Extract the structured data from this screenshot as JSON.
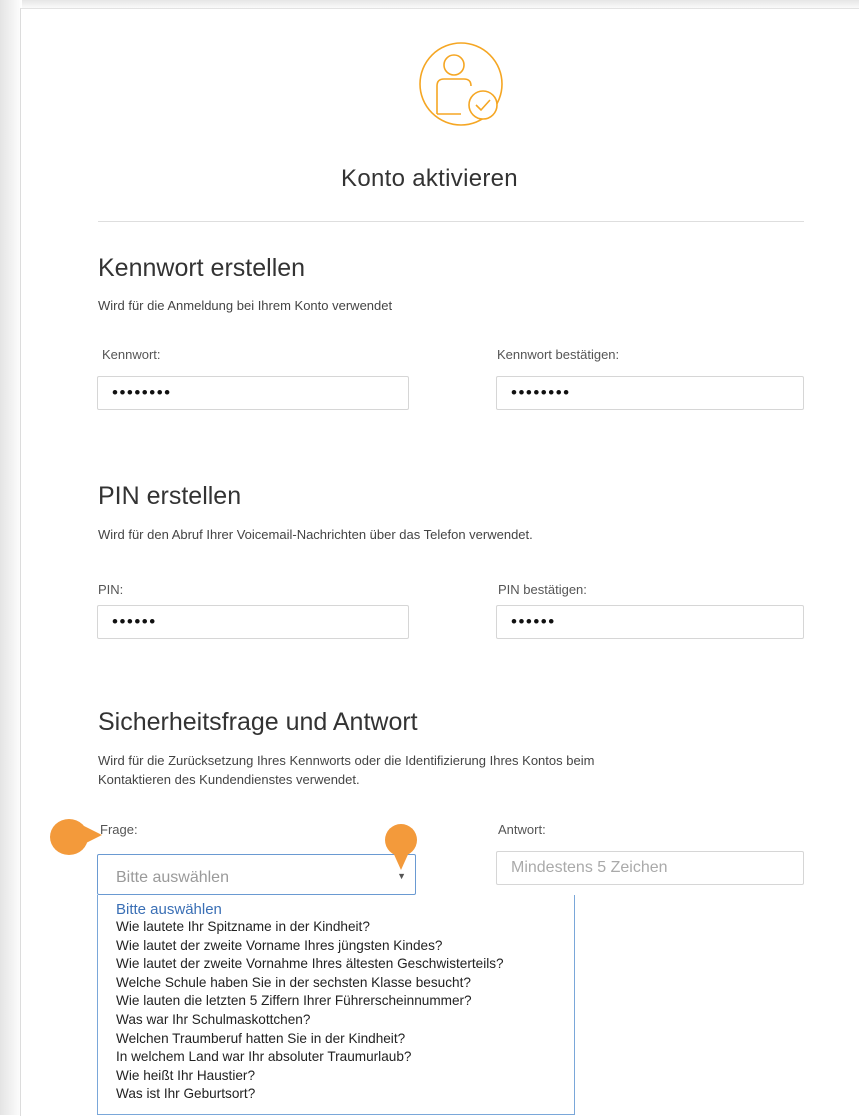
{
  "title": "Konto aktivieren",
  "colors": {
    "accent": "#f5a623",
    "select_border": "#6a9ad2",
    "marker": "#f39a3b",
    "selected_option": "#3a6fb5"
  },
  "password_section": {
    "heading": "Kennwort erstellen",
    "description": "Wird für die Anmeldung bei Ihrem Konto verwendet",
    "password_label": "Kennwort:",
    "password_value": "••••••••",
    "confirm_label": "Kennwort bestätigen:",
    "confirm_value": "••••••••"
  },
  "pin_section": {
    "heading": "PIN erstellen",
    "description": "Wird für den Abruf Ihrer Voicemail-Nachrichten über das Telefon verwendet.",
    "pin_label": "PIN:",
    "pin_value": "••••••",
    "confirm_label": "PIN bestätigen:",
    "confirm_value": "••••••"
  },
  "security_section": {
    "heading": "Sicherheitsfrage und Antwort",
    "description_line1": "Wird für die Zurücksetzung Ihres Kennworts oder die Identifizierung Ihres Kontos beim",
    "description_line2": "Kontaktieren des Kundendienstes verwendet.",
    "question_label": "Frage:",
    "question_selected": "Bitte auswählen",
    "answer_label": "Antwort:",
    "answer_placeholder": "Mindestens 5 Zeichen",
    "options": [
      "Bitte auswählen",
      "Wie lautete Ihr Spitzname in der Kindheit?",
      "Wie lautet der zweite Vorname Ihres jüngsten Kindes?",
      "Wie lautet der zweite Vornahme Ihres ältesten Geschwisterteils?",
      "Welche Schule haben Sie in der sechsten Klasse besucht?",
      "Wie lauten die letzten 5 Ziffern Ihrer Führerscheinnummer?",
      "Was war Ihr Schulmaskottchen?",
      "Welchen Traumberuf hatten Sie in der Kindheit?",
      "In welchem Land war Ihr absoluter Traumurlaub?",
      "Wie heißt Ihr Haustier?",
      "Was ist Ihr Geburtsort?"
    ]
  },
  "icons": {
    "header": "user-check-icon",
    "dropdown": "chevron-down-icon"
  }
}
